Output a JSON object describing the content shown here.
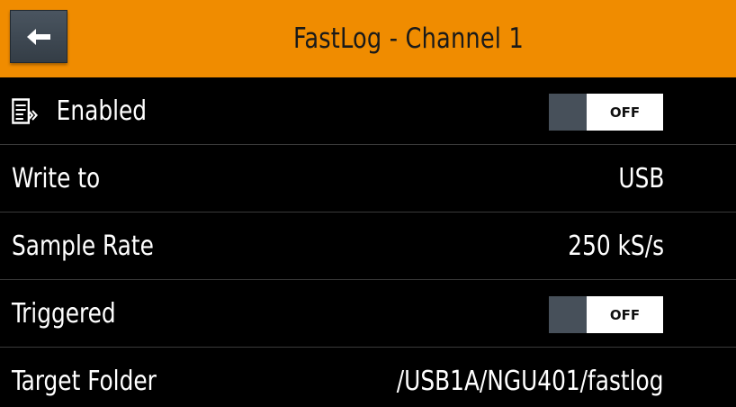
{
  "header": {
    "title": "FastLog - Channel 1",
    "back_icon": "arrow-left-icon"
  },
  "rows": [
    {
      "label": "Enabled",
      "icon": "log-list-icon",
      "control": "toggle",
      "value": "OFF"
    },
    {
      "label": "Write to",
      "control": "value",
      "value": "USB"
    },
    {
      "label": "Sample Rate",
      "control": "value",
      "value": "250 kS/s"
    },
    {
      "label": "Triggered",
      "control": "toggle",
      "value": "OFF"
    },
    {
      "label": "Target Folder",
      "control": "value",
      "value": "/USB1A/NGU401/fastlog"
    }
  ],
  "colors": {
    "title_bar": "#f08c00",
    "background": "#000000",
    "toggle_knob": "#47505a"
  }
}
